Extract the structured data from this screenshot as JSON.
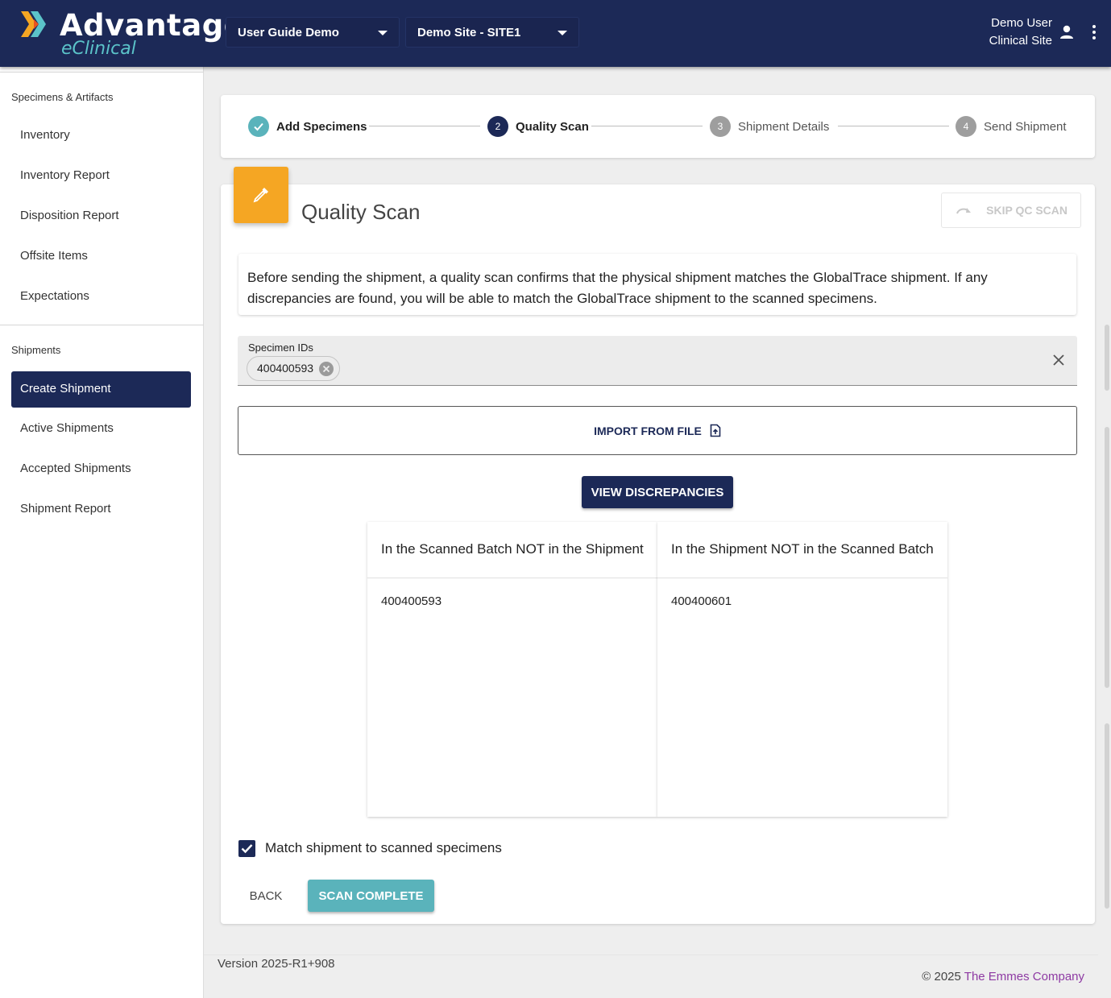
{
  "header": {
    "logo_title": "Advantage",
    "logo_sub": "eClinical",
    "study_select": "User Guide Demo",
    "site_select": "Demo Site - SITE1",
    "user_name": "Demo User",
    "user_role": "Clinical Site"
  },
  "sidebar": {
    "section1": "Specimens & Artifacts",
    "items1": [
      "Inventory",
      "Inventory Report",
      "Disposition Report",
      "Offsite Items",
      "Expectations"
    ],
    "section2": "Shipments",
    "items2": [
      "Create Shipment",
      "Active Shipments",
      "Accepted Shipments",
      "Shipment Report"
    ],
    "active_item": "Create Shipment"
  },
  "stepper": {
    "steps": [
      {
        "num": "",
        "label": "Add Specimens",
        "state": "done"
      },
      {
        "num": "2",
        "label": "Quality Scan",
        "state": "active"
      },
      {
        "num": "3",
        "label": "Shipment Details",
        "state": "pending"
      },
      {
        "num": "4",
        "label": "Send Shipment",
        "state": "pending"
      }
    ]
  },
  "quality": {
    "title": "Quality Scan",
    "skip_label": "SKIP QC SCAN",
    "info_text": "Before sending the shipment, a quality scan confirms that the physical shipment matches the GlobalTrace shipment. If any discrepancies are found, you will be able to match the GlobalTrace shipment to the scanned specimens.",
    "specimen_field_label": "Specimen IDs",
    "specimen_chips": [
      "400400593"
    ],
    "import_label": "IMPORT FROM FILE",
    "view_discrepancies_label": "VIEW DISCREPANCIES",
    "discrepancies": {
      "left_header": "In the Scanned Batch NOT in the Shipment",
      "left_rows": [
        "400400593"
      ],
      "right_header": "In the Shipment NOT in the Scanned Batch",
      "right_rows": [
        "400400601"
      ]
    },
    "match_checkbox_label": "Match shipment to scanned specimens",
    "match_checked": true,
    "back_label": "BACK",
    "scan_complete_label": "SCAN COMPLETE"
  },
  "footer": {
    "version": "Version 2025-R1+908",
    "copyright_prefix": "© 2025",
    "company": "The Emmes Company"
  },
  "colors": {
    "navy": "#1c2957",
    "teal": "#5ab3bb",
    "orange": "#f5a623",
    "link_purple": "#8e3aa3"
  }
}
